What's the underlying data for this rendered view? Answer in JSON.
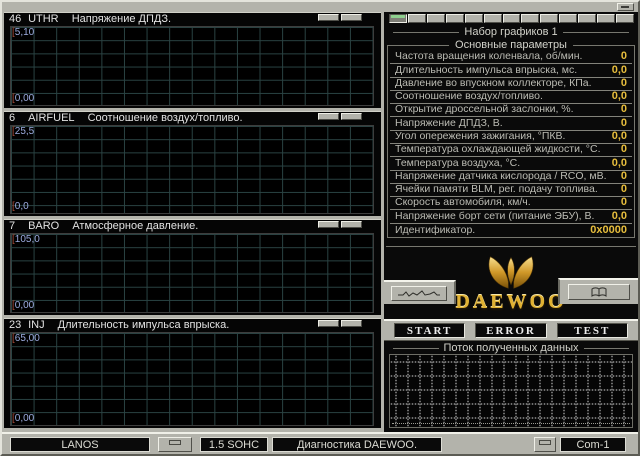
{
  "window": {
    "app_title": "Диагностика DAEWOO."
  },
  "panels": [
    {
      "id": "46",
      "code": "UTHR",
      "title": "Напряжение ДПДЗ.",
      "ymax": "5,10",
      "ymin": "0,00",
      "bracket": "["
    },
    {
      "id": "6",
      "code": "AIRFUEL",
      "title": "Соотношение воздух/топливо.",
      "ymax": "25,5",
      "ymin": "0,0",
      "bracket": "["
    },
    {
      "id": "7",
      "code": "BARO",
      "title": "Атмосферное давление.",
      "ymax": "105,0",
      "ymin": "0,00",
      "bracket": "["
    },
    {
      "id": "23",
      "code": "INJ",
      "title": "Длительность импульса впрыска.",
      "ymax": "65,00",
      "ymin": "0,00",
      "bracket": "["
    }
  ],
  "right": {
    "set_title": "Набор графиков 1",
    "group_title": "Основные параметры",
    "params": [
      {
        "label": "Частота вращения коленвала, об/мин.",
        "value": "0"
      },
      {
        "label": "Длительность импульса впрыска, мс.",
        "value": "0,0"
      },
      {
        "label": "Давление во впускном коллекторе, КПа.",
        "value": "0"
      },
      {
        "label": "Соотношение воздух/топливо.",
        "value": "0,0"
      },
      {
        "label": "Открытие дроссельной заслонки, %.",
        "value": "0"
      },
      {
        "label": "Напряжение ДПДЗ, В.",
        "value": "0"
      },
      {
        "label": "Угол опережения зажигания, °ПКВ.",
        "value": "0,0"
      },
      {
        "label": "Температура охлаждающей жидкости, °С.",
        "value": "0"
      },
      {
        "label": "Температура воздуха, °С.",
        "value": "0,0"
      },
      {
        "label": "Напряжение датчика кислорода / RCO, мВ.",
        "value": "0"
      },
      {
        "label": "Ячейки памяти BLM, рег. подачу топлива.",
        "value": "0"
      },
      {
        "label": "Скорость автомобиля, км/ч.",
        "value": "0"
      },
      {
        "label": "Напряжение борт сети (питание ЭБУ), В.",
        "value": "0,0"
      },
      {
        "label": "Идентификатор.",
        "value": "0x0000"
      }
    ],
    "brand": "DAEWOO",
    "buttons": {
      "start": "START",
      "error": "ERROR",
      "test": "TEST"
    },
    "stream_title": "Поток полученных данных"
  },
  "statusbar": {
    "model": "LANOS",
    "engine": "1.5 SOHC",
    "mode": "Диагностика DAEWOO.",
    "port": "Com-1"
  },
  "icons": {
    "top_right": "window-restore-icon",
    "left_tool": "waveform-icon",
    "right_tool": "book-icon"
  },
  "colors": {
    "chrome_gray": "#b3b3ab",
    "panel_black": "#050505",
    "grid_line": "#2a4343",
    "axis_label_blue": "#9cabdf",
    "axis_bracket_red": "#a84c38",
    "value_gold": "#e6bd3c",
    "active_tab_green": "#8ed08e",
    "brand_gold": "#e0b132"
  }
}
